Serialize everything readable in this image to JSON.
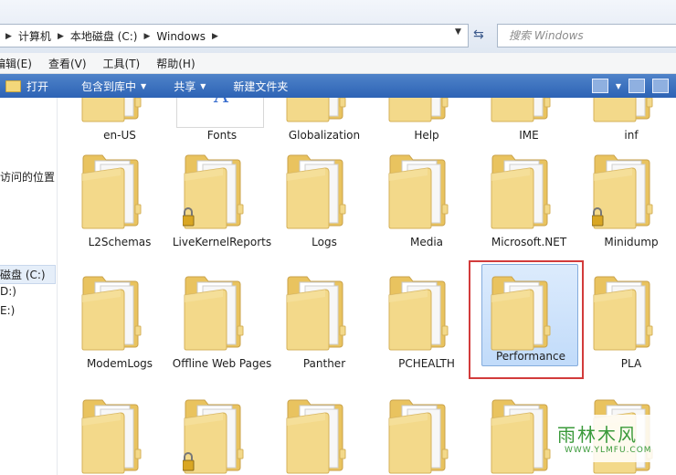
{
  "address_bar": {
    "breadcrumbs": [
      "计算机",
      "本地磁盘 (C:)",
      "Windows"
    ],
    "search_placeholder": "搜索 Windows"
  },
  "menu": [
    "编辑(E)",
    "查看(V)",
    "工具(T)",
    "帮助(H)"
  ],
  "commands": {
    "open": "打开",
    "include_in_library": "包含到库中",
    "share": "共享",
    "new_folder": "新建文件夹"
  },
  "nav": {
    "recent": "访问的位置",
    "drives": [
      "磁盘 (C:)",
      "D:)",
      "E:)"
    ]
  },
  "folders": [
    {
      "name": "en-US",
      "row": 0,
      "col": 0
    },
    {
      "name": "Fonts",
      "row": 0,
      "col": 1
    },
    {
      "name": "Globalization",
      "row": 0,
      "col": 2
    },
    {
      "name": "Help",
      "row": 0,
      "col": 3
    },
    {
      "name": "IME",
      "row": 0,
      "col": 4
    },
    {
      "name": "inf",
      "row": 0,
      "col": 5
    },
    {
      "name": "L2Schemas",
      "row": 1,
      "col": 0
    },
    {
      "name": "LiveKernelReports",
      "row": 1,
      "col": 1,
      "locked": true
    },
    {
      "name": "Logs",
      "row": 1,
      "col": 2
    },
    {
      "name": "Media",
      "row": 1,
      "col": 3
    },
    {
      "name": "Microsoft.NET",
      "row": 1,
      "col": 4
    },
    {
      "name": "Minidump",
      "row": 1,
      "col": 5,
      "locked": true
    },
    {
      "name": "ModemLogs",
      "row": 2,
      "col": 0
    },
    {
      "name": "Offline Web Pages",
      "row": 2,
      "col": 1
    },
    {
      "name": "Panther",
      "row": 2,
      "col": 2
    },
    {
      "name": "PCHEALTH",
      "row": 2,
      "col": 3
    },
    {
      "name": "Performance",
      "row": 2,
      "col": 4,
      "selected": true
    },
    {
      "name": "PLA",
      "row": 2,
      "col": 5
    },
    {
      "name": "",
      "row": 3,
      "col": 0
    },
    {
      "name": "",
      "row": 3,
      "col": 1,
      "locked": true
    },
    {
      "name": "",
      "row": 3,
      "col": 2
    },
    {
      "name": "",
      "row": 3,
      "col": 3
    },
    {
      "name": "",
      "row": 3,
      "col": 4
    },
    {
      "name": "",
      "row": 3,
      "col": 5
    }
  ],
  "watermark": {
    "text": "雨林木风",
    "url": "WWW.YLMFU.COM"
  },
  "colors": {
    "command_bar": "#2d63b5",
    "folder": "#f0d27a",
    "selection": "#c1dbfa",
    "highlight": "#d23b3b"
  }
}
